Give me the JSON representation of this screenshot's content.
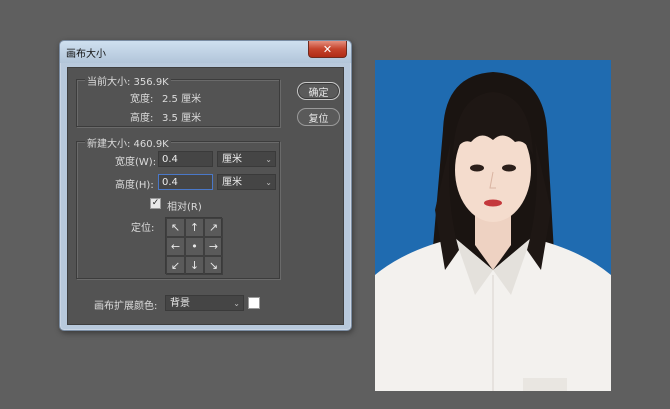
{
  "dialog": {
    "title": "画布大小",
    "close_label": "✕",
    "current": {
      "title": "当前大小: 356.9K",
      "width_label": "宽度:",
      "width_value": "2.5 厘米",
      "height_label": "高度:",
      "height_value": "3.5 厘米"
    },
    "new": {
      "title": "新建大小: 460.9K",
      "width_label": "宽度(W):",
      "width_value": "0.4",
      "width_unit": "厘米",
      "height_label": "高度(H):",
      "height_value": "0.4",
      "height_unit": "厘米",
      "relative_label": "相对(R)",
      "relative_checked": true,
      "anchor_label": "定位:",
      "anchor_cells": [
        "↖",
        "↑",
        "↗",
        "←",
        "•",
        "→",
        "↙",
        "↓",
        "↘"
      ]
    },
    "extension": {
      "label": "画布扩展颜色:",
      "value": "背景",
      "swatch_color": "#ffffff"
    },
    "ok_label": "确定",
    "reset_label": "复位"
  },
  "canvas": {
    "background_color": "#5f5f5f",
    "photo_background": "#1e6aae"
  }
}
